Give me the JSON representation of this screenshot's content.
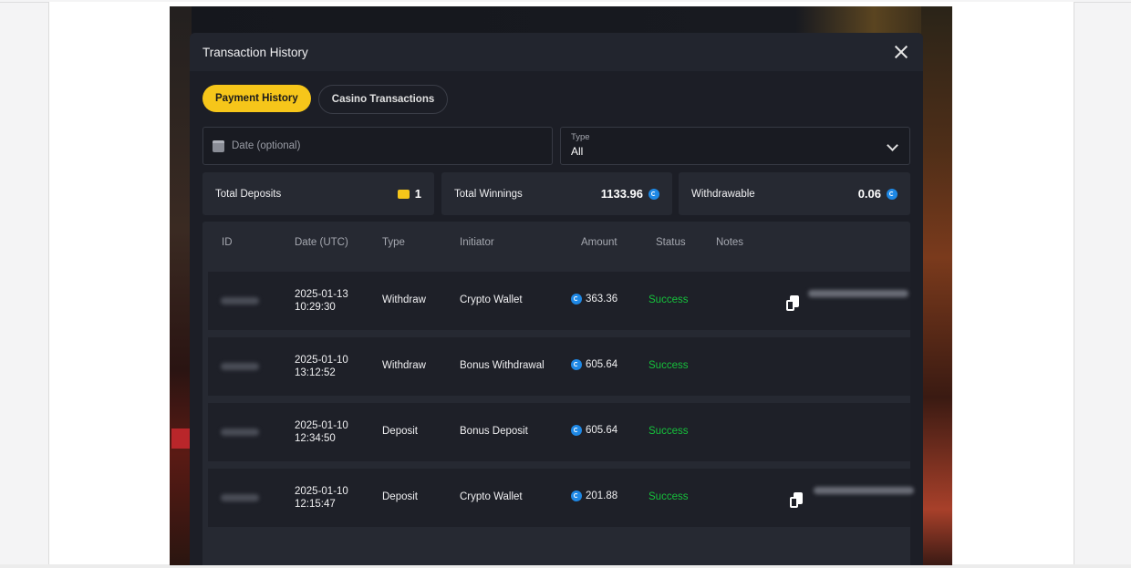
{
  "modal": {
    "title": "Transaction History"
  },
  "tabs": [
    {
      "label": "Payment History",
      "active": true
    },
    {
      "label": "Casino Transactions",
      "active": false
    }
  ],
  "filters": {
    "date_placeholder": "Date (optional)",
    "type_label": "Type",
    "type_value": "All"
  },
  "stats": {
    "total_deposits_label": "Total Deposits",
    "total_deposits_value": "1",
    "total_winnings_label": "Total Winnings",
    "total_winnings_value": "1133.96",
    "withdrawable_label": "Withdrawable",
    "withdrawable_value": "0.06"
  },
  "table": {
    "columns": [
      "ID",
      "Date (UTC)",
      "Type",
      "Initiator",
      "Amount",
      "Status",
      "Notes"
    ],
    "rows": [
      {
        "date": "2025-01-13",
        "time": "10:29:30",
        "type": "Withdraw",
        "initiator": "Crypto Wallet",
        "amount": "363.36",
        "status": "Success",
        "has_note": true
      },
      {
        "date": "2025-01-10",
        "time": "13:12:52",
        "type": "Withdraw",
        "initiator": "Bonus Withdrawal",
        "amount": "605.64",
        "status": "Success",
        "has_note": false
      },
      {
        "date": "2025-01-10",
        "time": "12:34:50",
        "type": "Deposit",
        "initiator": "Bonus Deposit",
        "amount": "605.64",
        "status": "Success",
        "has_note": false
      },
      {
        "date": "2025-01-10",
        "time": "12:15:47",
        "type": "Deposit",
        "initiator": "Crypto Wallet",
        "amount": "201.88",
        "status": "Success",
        "has_note": true
      }
    ]
  },
  "colors": {
    "accent": "#f6c61a",
    "success": "#16c13c",
    "coin": "#1e88e5",
    "modal_bg": "#1c1e26"
  }
}
